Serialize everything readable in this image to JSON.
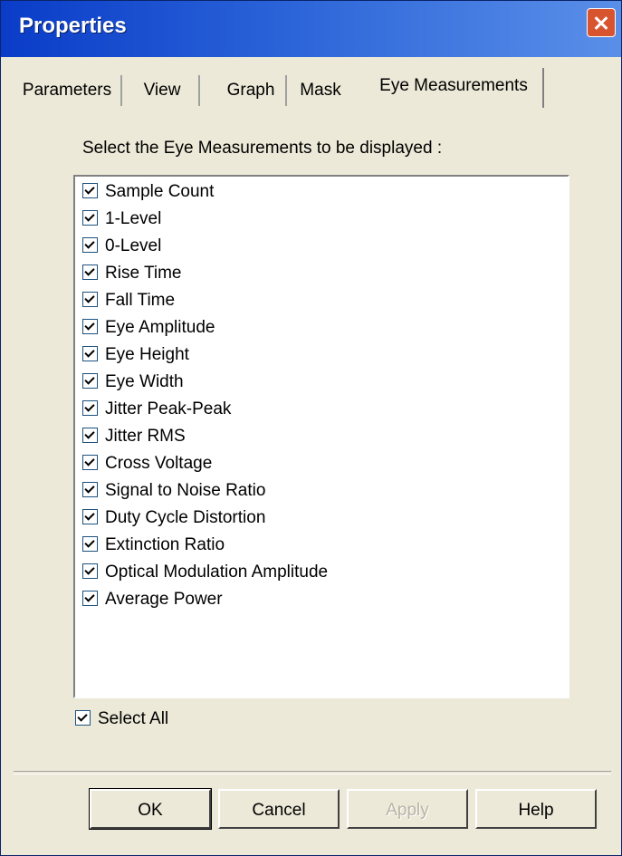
{
  "window": {
    "title": "Properties",
    "close_icon": "close-icon"
  },
  "tabs": [
    {
      "label": "Parameters",
      "active": false
    },
    {
      "label": "View",
      "active": false
    },
    {
      "label": "Graph",
      "active": false
    },
    {
      "label": "Mask",
      "active": false
    },
    {
      "label": "Eye Measurements",
      "active": true
    }
  ],
  "instruction": "Select the Eye Measurements to be displayed :",
  "measurements": [
    {
      "label": "Sample Count",
      "checked": true
    },
    {
      "label": "1-Level",
      "checked": true
    },
    {
      "label": "0-Level",
      "checked": true
    },
    {
      "label": "Rise Time",
      "checked": true
    },
    {
      "label": "Fall Time",
      "checked": true
    },
    {
      "label": "Eye Amplitude",
      "checked": true
    },
    {
      "label": "Eye Height",
      "checked": true
    },
    {
      "label": "Eye Width",
      "checked": true
    },
    {
      "label": "Jitter Peak-Peak",
      "checked": true
    },
    {
      "label": "Jitter RMS",
      "checked": true
    },
    {
      "label": "Cross Voltage",
      "checked": true
    },
    {
      "label": "Signal to Noise Ratio",
      "checked": true
    },
    {
      "label": "Duty Cycle Distortion",
      "checked": true
    },
    {
      "label": "Extinction Ratio",
      "checked": true
    },
    {
      "label": "Optical Modulation Amplitude",
      "checked": true
    },
    {
      "label": "Average Power",
      "checked": true
    }
  ],
  "select_all": {
    "label": "Select All",
    "checked": true
  },
  "buttons": {
    "ok": "OK",
    "cancel": "Cancel",
    "apply": "Apply",
    "help": "Help"
  },
  "colors": {
    "title_bar": "#0a3cc8",
    "dialog_bg": "#ece9d8",
    "close_button": "#d8542f"
  }
}
